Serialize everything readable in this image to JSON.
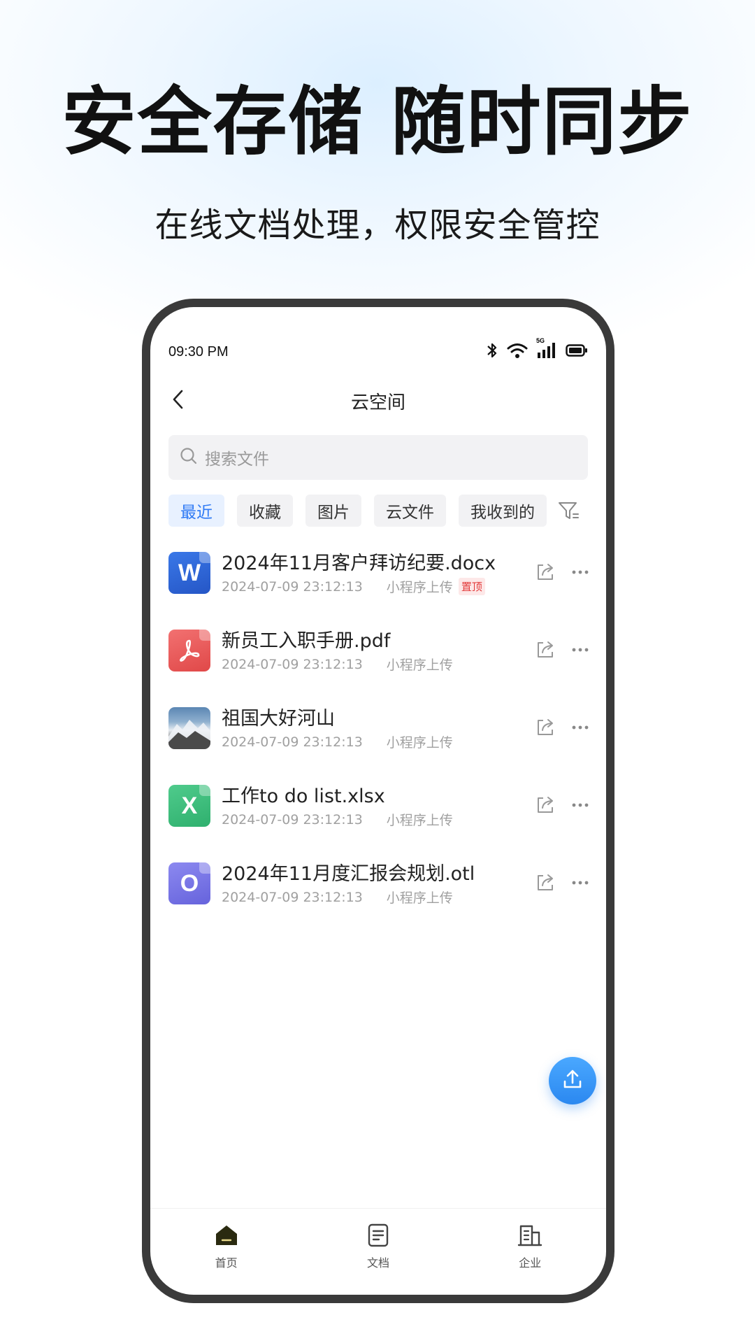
{
  "hero": {
    "title": "安全存储 随时同步",
    "subtitle": "在线文档处理，权限安全管控"
  },
  "status_bar": {
    "time": "09:30 PM",
    "network": "5G",
    "icons": [
      "bluetooth-icon",
      "wifi-icon",
      "signal-icon",
      "battery-icon"
    ]
  },
  "navbar": {
    "title": "云空间",
    "back_icon": "chevron-left-icon"
  },
  "search": {
    "placeholder": "搜索文件",
    "icon": "search-icon"
  },
  "tabs": [
    {
      "label": "最近",
      "active": true
    },
    {
      "label": "收藏",
      "active": false
    },
    {
      "label": "图片",
      "active": false
    },
    {
      "label": "云文件",
      "active": false
    },
    {
      "label": "我收到的",
      "active": false
    }
  ],
  "files": [
    {
      "name": "2024年11月客户拜访纪要.docx",
      "time": "2024-07-09 23:12:13",
      "source": "小程序上传",
      "badge": "置顶",
      "type": "word",
      "icon_letter": "W"
    },
    {
      "name": "新员工入职手册.pdf",
      "time": "2024-07-09 23:12:13",
      "source": "小程序上传",
      "badge": "",
      "type": "pdf",
      "icon_letter": ""
    },
    {
      "name": "祖国大好河山",
      "time": "2024-07-09 23:12:13",
      "source": "小程序上传",
      "badge": "",
      "type": "image",
      "icon_letter": ""
    },
    {
      "name": "工作to do list.xlsx",
      "time": "2024-07-09 23:12:13",
      "source": "小程序上传",
      "badge": "",
      "type": "excel",
      "icon_letter": "X"
    },
    {
      "name": "2024年11月度汇报会规划.otl",
      "time": "2024-07-09 23:12:13",
      "source": "小程序上传",
      "badge": "",
      "type": "outline",
      "icon_letter": "O"
    }
  ],
  "bottom_nav": [
    {
      "label": "首页",
      "icon": "home-icon",
      "active": true
    },
    {
      "label": "文档",
      "icon": "document-icon",
      "active": false
    },
    {
      "label": "企业",
      "icon": "building-icon",
      "active": false
    }
  ],
  "colors": {
    "accent": "#2f7af5",
    "word": "#2b63d9",
    "pdf": "#ec5b5b",
    "excel": "#3dbd7d",
    "outline": "#7b78e8",
    "pin_badge": "#e33b3b"
  }
}
